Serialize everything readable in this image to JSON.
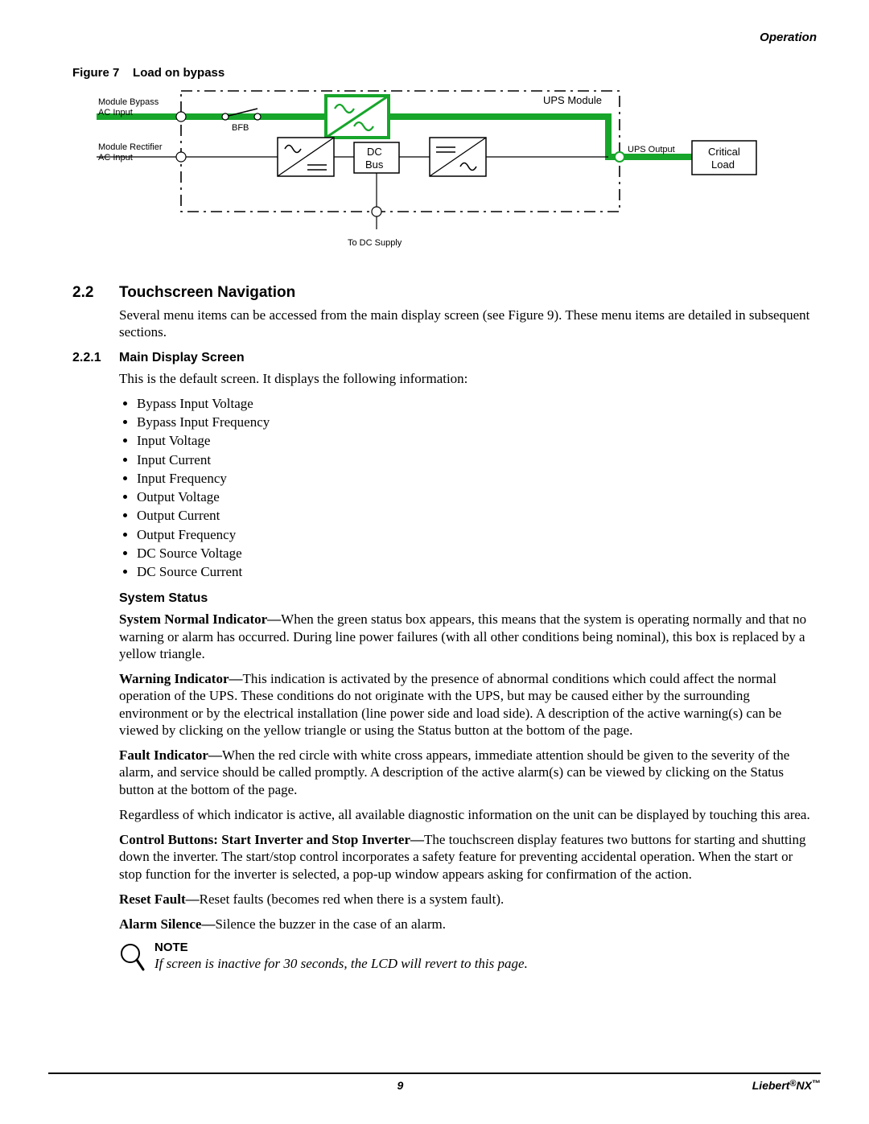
{
  "header": {
    "section": "Operation"
  },
  "figure": {
    "label": "Figure 7",
    "title": "Load on bypass",
    "labels": {
      "module_bypass": "Module Bypass",
      "ac_input": "AC Input",
      "module_rectifier": "Module Rectifier",
      "bfb": "BFB",
      "ups_module": "UPS Module",
      "dc_bus_top": "DC",
      "dc_bus_bottom": "Bus",
      "ups_output": "UPS Output",
      "critical_load_top": "Critical",
      "critical_load_bottom": "Load",
      "to_dc_supply": "To DC Supply"
    }
  },
  "sec22": {
    "num": "2.2",
    "title": "Touchscreen Navigation",
    "intro": "Several menu items can be accessed from the main display screen (see Figure 9). These menu items are detailed in subsequent sections."
  },
  "sec221": {
    "num": "2.2.1",
    "title": "Main Display Screen",
    "intro": "This is the default screen. It displays the following information:",
    "items": [
      "Bypass Input Voltage",
      "Bypass Input Frequency",
      "Input Voltage",
      "Input Current",
      "Input Frequency",
      "Output Voltage",
      "Output Current",
      "Output Frequency",
      "DC Source Voltage",
      "DC Source Current"
    ]
  },
  "system_status": {
    "heading": "System Status",
    "p1_lead": "System Normal Indicator—",
    "p1_body": "When the green status box appears, this means that the system is operating normally and that no warning or alarm has occurred. During line power failures (with all other conditions being nominal), this box is replaced by a yellow triangle.",
    "p2_lead": "Warning Indicator—",
    "p2_body": "This indication is activated by the presence of abnormal conditions which could affect the normal operation of the UPS. These conditions do not originate with the UPS, but may be caused either by the surrounding environment or by the electrical installation (line power side and load side). A description of the active warning(s) can be viewed by clicking on the yellow triangle or using the Status button at the bottom of the page.",
    "p3_lead": "Fault Indicator—",
    "p3_body": "When the red circle with white cross appears, immediate attention should be given to the severity of the alarm, and service should be called promptly. A description of the active alarm(s) can be viewed by clicking on the Status button at the bottom of the page.",
    "p4": "Regardless of which indicator is active, all available diagnostic information on the unit can be displayed by touching this area.",
    "p5_lead": "Control Buttons: Start Inverter and Stop Inverter—",
    "p5_body": "The touchscreen display features two buttons for starting and shutting down the inverter. The start/stop control incorporates a safety feature for preventing accidental operation. When the start or stop function for the inverter is selected, a pop-up window appears asking for confirmation of the action.",
    "p6_lead": "Reset Fault—",
    "p6_body": "Reset faults (becomes red when there is a system fault).",
    "p7_lead": "Alarm Silence—",
    "p7_body": "Silence the buzzer in the case of an alarm."
  },
  "note": {
    "label": "NOTE",
    "text": "If screen is inactive for 30 seconds, the LCD will revert to this page."
  },
  "footer": {
    "page": "9",
    "brand_lead": "Liebert",
    "brand_tail": "NX",
    "reg": "®",
    "tm": "™"
  }
}
